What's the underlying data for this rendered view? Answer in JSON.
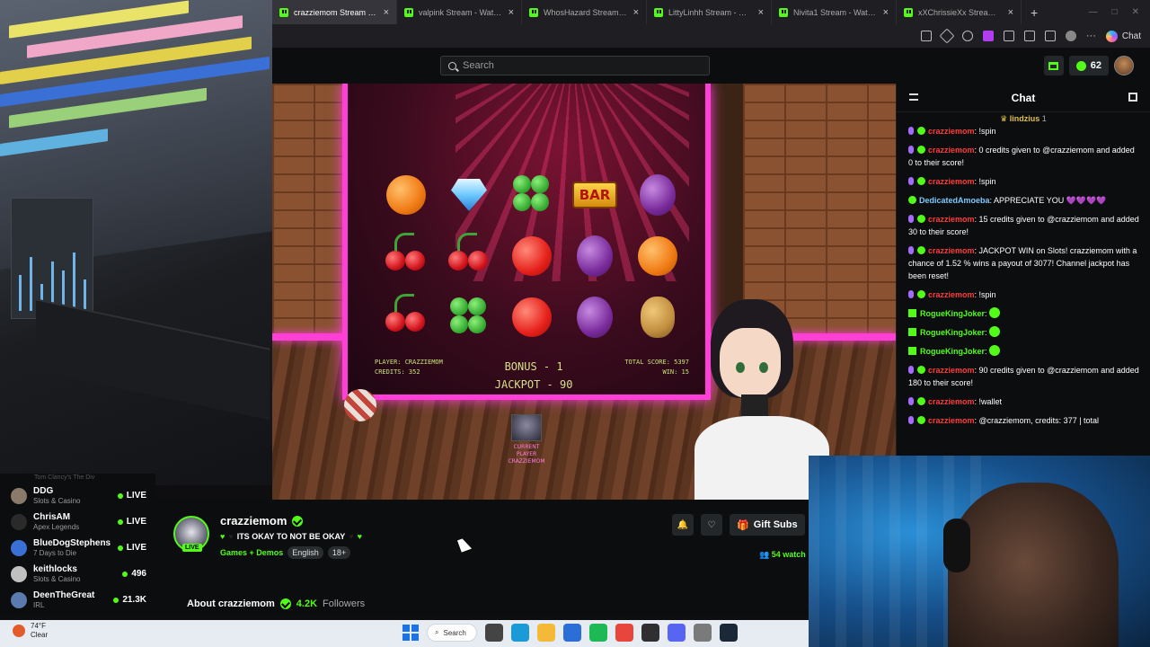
{
  "browser": {
    "tabs": [
      {
        "title": "crazziemom Stream - W",
        "active": true,
        "icon": "kick-icon"
      },
      {
        "title": "valpink Stream - Watch Live",
        "active": false,
        "icon": "kick-icon"
      },
      {
        "title": "WhosHazard Stream - Watch",
        "active": false,
        "icon": "kick-icon"
      },
      {
        "title": "LittyLinhh Stream - Watch L",
        "active": false,
        "icon": "kick-icon"
      },
      {
        "title": "Nivita1 Stream - Watch Live",
        "active": false,
        "icon": "kick-icon"
      },
      {
        "title": "xXChrissieXx Stream - W",
        "active": false,
        "icon": "kick-icon"
      }
    ],
    "new_tab": "+",
    "copilot_label": "Chat"
  },
  "site": {
    "search_placeholder": "Search",
    "points": "62"
  },
  "slot": {
    "rows": [
      [
        "orange",
        "diamond",
        "clover",
        "bar",
        "plum"
      ],
      [
        "cherry",
        "cherry",
        "apple",
        "plum",
        "orange"
      ],
      [
        "cherry",
        "clover",
        "apple",
        "plum",
        "potato"
      ]
    ],
    "bar_label": "BAR",
    "player": "PLAYER: CRAZZIEMOM",
    "credits": "CREDITS: 352",
    "bonus": "BONUS - 1",
    "jackpot": "JACKPOT - 90",
    "total_score": "TOTAL SCORE: 5397",
    "win": "WIN: 15",
    "current_player_1": "CURRENT PLAYER",
    "current_player_2": "CRAZZIEMOM"
  },
  "sidebar": {
    "cut_text": "Tom Clancy's The Div",
    "channels": [
      {
        "name": "DDG",
        "category": "Slots & Casino",
        "viewers": "LIVE",
        "avatar_color": "#8a7a6a"
      },
      {
        "name": "ChrisAM",
        "category": "Apex Legends",
        "viewers": "LIVE",
        "avatar_color": "#2a2a2a"
      },
      {
        "name": "BlueDogStephens",
        "category": "7 Days to Die",
        "viewers": "LIVE",
        "avatar_color": "#3a6fd6"
      },
      {
        "name": "keithlocks",
        "category": "Slots & Casino",
        "viewers": "496",
        "avatar_color": "#c0c0c0"
      },
      {
        "name": "DeenTheGreat",
        "category": "IRL",
        "viewers": "21.3K",
        "avatar_color": "#5a7ab0"
      }
    ]
  },
  "channel": {
    "name": "crazziemom",
    "live_badge": "LIVE",
    "title": "ITS OKAY TO NOT BE OKAY",
    "category": "Games + Demos",
    "tags": [
      "English",
      "18+"
    ],
    "gift_subs": "Gift Subs",
    "watching": "54 watch",
    "about_label": "About crazziemom",
    "followers_count": "4.2K",
    "followers_label": "Followers"
  },
  "chat": {
    "title": "Chat",
    "pinned_user": "lindzius",
    "pinned_count": "1",
    "messages": [
      {
        "user": "crazziemom",
        "color": "red",
        "badges": [
          "sub",
          "verified"
        ],
        "text": ": !spin"
      },
      {
        "user": "crazziemom",
        "color": "red",
        "badges": [
          "sub",
          "verified"
        ],
        "text": ": 0 credits given to @crazziemom and added 0 to their score!"
      },
      {
        "user": "crazziemom",
        "color": "red",
        "badges": [
          "sub",
          "verified"
        ],
        "text": ": !spin"
      },
      {
        "user": "DedicatedAmoeba",
        "color": "blue",
        "badges": [
          "verified"
        ],
        "text": ": APPRECIATE YOU 💜💜💜💜"
      },
      {
        "user": "crazziemom",
        "color": "red",
        "badges": [
          "sub",
          "verified"
        ],
        "text": ": 15 credits given to @crazziemom and added 30 to their score!"
      },
      {
        "user": "crazziemom",
        "color": "red",
        "badges": [
          "sub",
          "verified"
        ],
        "text": ": JACKPOT WIN on Slots! crazziemom with a chance of 1.52 % wins a payout of 3077! Channel jackpot has been reset!"
      },
      {
        "user": "crazziemom",
        "color": "red",
        "badges": [
          "sub",
          "verified"
        ],
        "text": ": !spin"
      },
      {
        "user": "RogueKingJoker",
        "color": "green",
        "badges": [
          "gift"
        ],
        "text": ":",
        "emote": true
      },
      {
        "user": "RogueKingJoker",
        "color": "green",
        "badges": [
          "gift"
        ],
        "text": ":",
        "emote": true
      },
      {
        "user": "RogueKingJoker",
        "color": "green",
        "badges": [
          "gift"
        ],
        "text": ":",
        "emote": true
      },
      {
        "user": "crazziemom",
        "color": "red",
        "badges": [
          "sub",
          "verified"
        ],
        "text": ": 90 credits given to @crazziemom and added 180 to their score!"
      },
      {
        "user": "crazziemom",
        "color": "red",
        "badges": [
          "sub",
          "verified"
        ],
        "text": ": !wallet"
      },
      {
        "user": "crazziemom",
        "color": "red",
        "badges": [
          "sub",
          "verified"
        ],
        "text": ": @crazziemom, credits: 377 | total"
      }
    ]
  },
  "taskbar": {
    "temperature": "74°F",
    "condition": "Clear",
    "search_label": "Search",
    "apps": [
      {
        "name": "task-view-icon",
        "color": "#444"
      },
      {
        "name": "edge-icon",
        "color": "#1a9bd7"
      },
      {
        "name": "file-explorer-icon",
        "color": "#f5b93a"
      },
      {
        "name": "store-icon",
        "color": "#2b6fd6"
      },
      {
        "name": "spotify-icon",
        "color": "#1db954"
      },
      {
        "name": "chrome-icon",
        "color": "#e8453c"
      },
      {
        "name": "obs-icon",
        "color": "#302e31"
      },
      {
        "name": "discord-icon",
        "color": "#5865f2"
      },
      {
        "name": "settings-icon",
        "color": "#7a7a7a"
      },
      {
        "name": "steam-icon",
        "color": "#1b2838"
      }
    ]
  },
  "colors": {
    "kick_green": "#53fc18",
    "neon_pink": "#ff3fd7",
    "chat_red_user": "#ff3c3c"
  }
}
